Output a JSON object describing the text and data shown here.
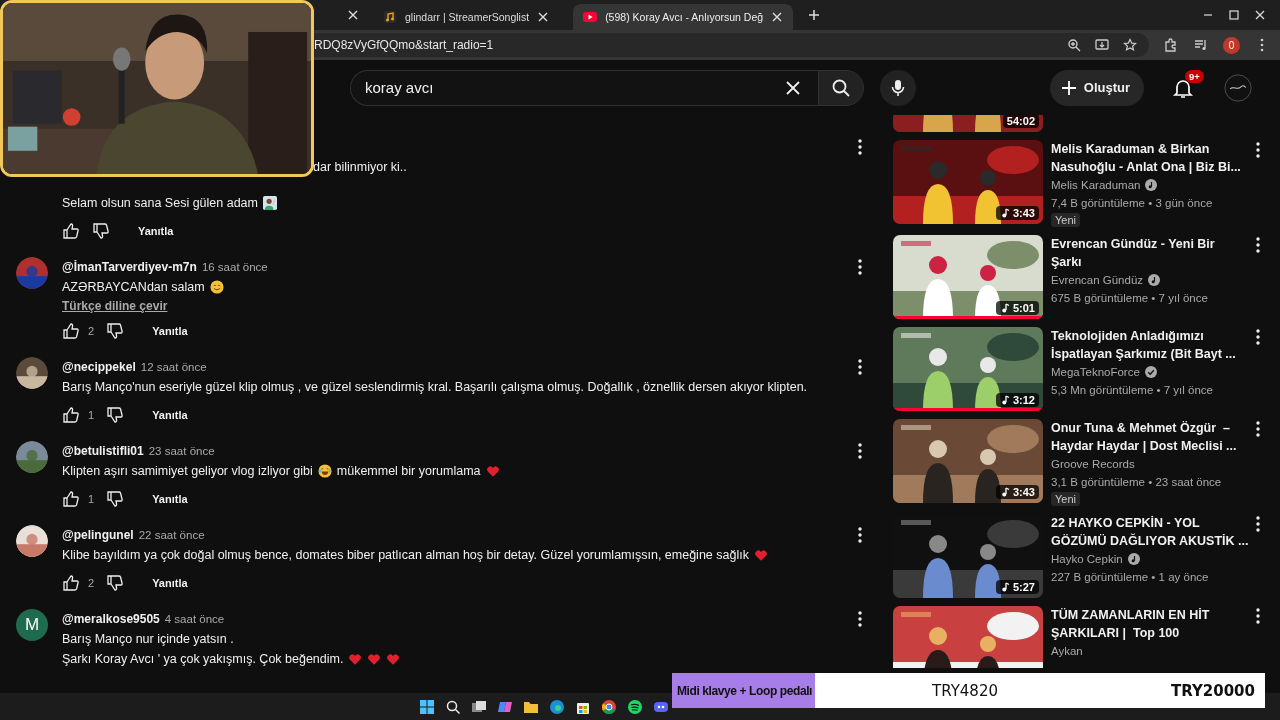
{
  "browser": {
    "tabs": [
      {
        "title": "glindarr | StreamerSonglist",
        "selected": false
      },
      {
        "title": "(598) Koray Avcı - Anlıyorsun Değ",
        "selected": true
      }
    ],
    "url": "RDQ8zVyGfQQmo&start_radio=1",
    "profile_badge": "0"
  },
  "header": {
    "search": {
      "value": "koray avcı"
    },
    "create_label": "Oluştur",
    "notification_count": "9+"
  },
  "comments": [
    {
      "covered_text": "dar bilinmiyor ki..",
      "lines": [
        [
          {
            "kind": "text",
            "text": "Selam olsun sana Sesi gülen adam"
          },
          {
            "kind": "wave"
          }
        ]
      ],
      "reply": "Yanıtla"
    },
    {
      "author": "@İmanTarverdiyev-m7n",
      "time": "16 saat önce",
      "avatar": {
        "kind": "picture"
      },
      "lines": [
        [
          {
            "kind": "text",
            "text": "AZƏRBAYCANdan salam"
          },
          {
            "kind": "smile"
          }
        ]
      ],
      "translate": "Türkçe diline çevir",
      "likes": "2",
      "reply": "Yanıtla"
    },
    {
      "author": "@necippekel",
      "time": "12 saat önce",
      "avatar": {
        "kind": "picture"
      },
      "lines": [
        [
          {
            "kind": "text",
            "text": "Barış Manço'nun eseriyle güzel klip olmuş , ve güzel seslendirmiş kral. Başarılı çalışma olmuş. Doğallık , öznellik dersen akıyor klipten."
          }
        ]
      ],
      "likes": "1",
      "reply": "Yanıtla"
    },
    {
      "author": "@betulistifli01",
      "time": "23 saat önce",
      "avatar": {
        "kind": "picture"
      },
      "lines": [
        [
          {
            "kind": "text",
            "text": "Klipten aşırı samimiyet geliyor vlog izliyor gibi"
          },
          {
            "kind": "laugh"
          },
          {
            "kind": "text",
            "text": "mükemmel bir yorumlama"
          },
          {
            "kind": "heart"
          }
        ]
      ],
      "likes": "1",
      "reply": "Yanıtla"
    },
    {
      "author": "@pelingunel",
      "time": "22 saat önce",
      "avatar": {
        "kind": "picture"
      },
      "lines": [
        [
          {
            "kind": "text",
            "text": "Klibe bayıldım ya çok doğal olmuş bence, domates biber patlıcan alman hoş bir detay. Güzel yorumlamışsın, emeğine sağlık"
          },
          {
            "kind": "heart"
          }
        ]
      ],
      "likes": "2",
      "reply": "Yanıtla"
    },
    {
      "author": "@meralkose9505",
      "time": "4 saat önce",
      "avatar": {
        "kind": "letter",
        "letter": "M",
        "color": "#1e6b50"
      },
      "lines": [
        [
          {
            "kind": "text",
            "text": "Barış Manço nur içinde yatsın ."
          }
        ],
        [
          {
            "kind": "text",
            "text": "Şarkı Koray Avcı ' ya çok yakışmış.  Çok beğendim."
          },
          {
            "kind": "heart"
          },
          {
            "kind": "heart"
          },
          {
            "kind": "heart"
          }
        ]
      ]
    }
  ],
  "related": [
    {
      "kind": "partial",
      "duration": "54:02",
      "music": false
    },
    {
      "kind": "full",
      "title": "Melis Karaduman & Birkan\nNasuhoğlu - Anlat Ona | Biz Bi...",
      "channel": "Melis Karaduman",
      "badge": {
        "kind": "music"
      },
      "meta": "7,4 B görüntüleme • 3 gün önce",
      "fresh": "Yeni",
      "duration": "3:43",
      "music": true,
      "watched": false
    },
    {
      "kind": "full",
      "title": "Evrencan Gündüz - Yeni Bir\nŞarkı",
      "channel": "Evrencan Gündüz",
      "badge": {
        "kind": "music"
      },
      "meta": "675 B görüntüleme • 7 yıl önce",
      "duration": "5:01",
      "music": true,
      "watched": true
    },
    {
      "kind": "full",
      "title": "Teknolojiden Anladığımızı\nİspatlayan Şarkımız (Bit Bayt ...",
      "channel": "MegaTeknoForce",
      "badge": {
        "kind": "check"
      },
      "meta": "5,3 Mn görüntüleme • 7 yıl önce",
      "duration": "3:12",
      "music": true,
      "watched": true
    },
    {
      "kind": "full",
      "title": "Onur Tuna & Mehmet Özgür  –\nHaydar Haydar | Dost Meclisi ...",
      "channel": "Groove Records",
      "meta": "3,1 B görüntüleme • 23 saat önce",
      "fresh": "Yeni",
      "duration": "3:43",
      "music": true,
      "watched": false
    },
    {
      "kind": "full",
      "title": "22 HAYKO CEPKİN - YOL\nGÖZÜMÜ DAĞLIYOR AKUSTİK ...",
      "channel": "Hayko Cepkin",
      "badge": {
        "kind": "music"
      },
      "meta": "227 B görüntüleme • 1 ay önce",
      "duration": "5:27",
      "music": true,
      "watched": false
    },
    {
      "kind": "cut",
      "title": "TÜM ZAMANLARIN EN HİT\nŞARKILARI |  Top 100",
      "channel": "Aykan",
      "watched": false
    }
  ],
  "donation_goal": {
    "title": "Midi klavye + Loop pedalı",
    "current": "TRY4820",
    "target": "TRY20000",
    "level": 0.241
  }
}
